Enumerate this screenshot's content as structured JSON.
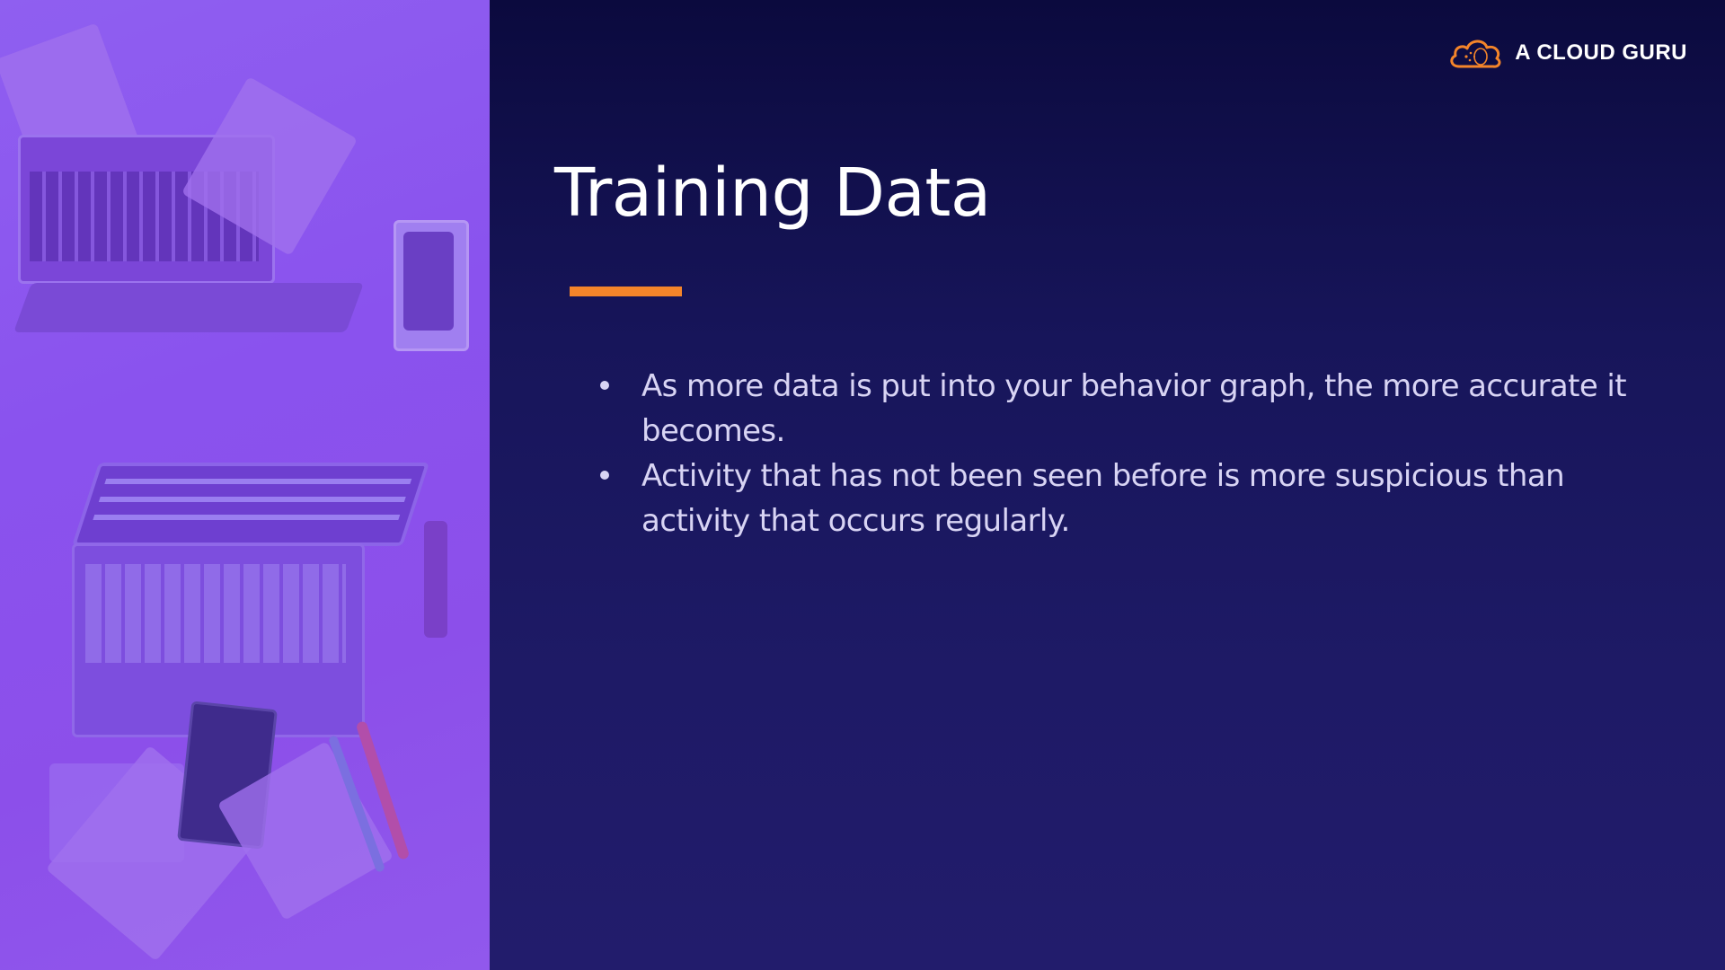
{
  "brand": {
    "logo_text": "A CLOUD GURU",
    "logo_icon": "cloud-icon",
    "accent_color": "#f4852a"
  },
  "slide": {
    "title": "Training Data",
    "bullets": [
      "As more data is put into your behavior graph, the more accurate it becomes.",
      "Activity that has not been seen before is more suspicious than activity that occurs regularly."
    ]
  },
  "colors": {
    "background": "#1a175e",
    "photo_overlay": "#8c55ee",
    "title": "#ffffff",
    "body_text": "#d8d4f4"
  }
}
